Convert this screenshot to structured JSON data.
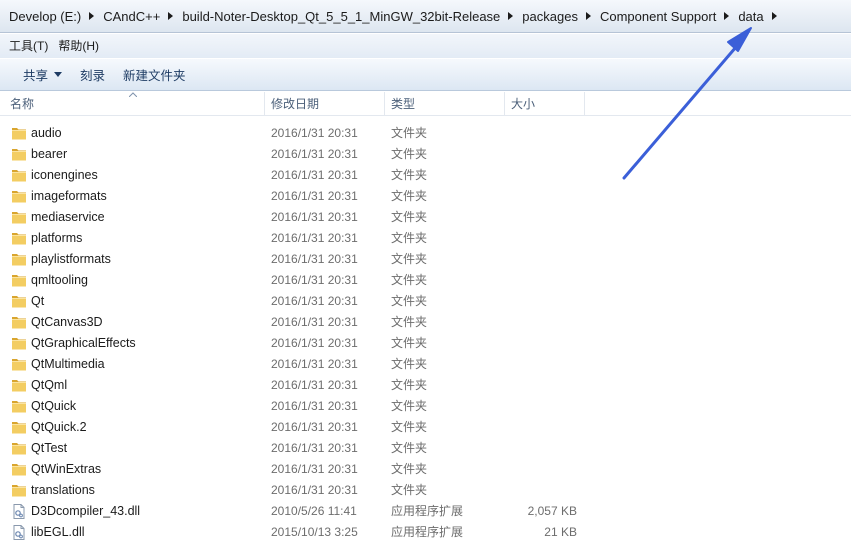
{
  "address": {
    "crumbs": [
      "Develop (E:)",
      "CAndC++",
      "build-Noter-Desktop_Qt_5_5_1_MinGW_32bit-Release",
      "packages",
      "Component Support",
      "data"
    ]
  },
  "menu": {
    "items": [
      "工具(T)",
      "帮助(H)"
    ]
  },
  "toolbar": {
    "share": "共享",
    "burn": "刻录",
    "new_folder": "新建文件夹"
  },
  "columns": {
    "name": "名称",
    "date": "修改日期",
    "type": "类型",
    "size": "大小"
  },
  "files": [
    {
      "name": "audio",
      "date": "2016/1/31 20:31",
      "type": "文件夹",
      "size": "",
      "icon": "folder-icon"
    },
    {
      "name": "bearer",
      "date": "2016/1/31 20:31",
      "type": "文件夹",
      "size": "",
      "icon": "folder-icon"
    },
    {
      "name": "iconengines",
      "date": "2016/1/31 20:31",
      "type": "文件夹",
      "size": "",
      "icon": "folder-icon"
    },
    {
      "name": "imageformats",
      "date": "2016/1/31 20:31",
      "type": "文件夹",
      "size": "",
      "icon": "folder-icon"
    },
    {
      "name": "mediaservice",
      "date": "2016/1/31 20:31",
      "type": "文件夹",
      "size": "",
      "icon": "folder-icon"
    },
    {
      "name": "platforms",
      "date": "2016/1/31 20:31",
      "type": "文件夹",
      "size": "",
      "icon": "folder-icon"
    },
    {
      "name": "playlistformats",
      "date": "2016/1/31 20:31",
      "type": "文件夹",
      "size": "",
      "icon": "folder-icon"
    },
    {
      "name": "qmltooling",
      "date": "2016/1/31 20:31",
      "type": "文件夹",
      "size": "",
      "icon": "folder-icon"
    },
    {
      "name": "Qt",
      "date": "2016/1/31 20:31",
      "type": "文件夹",
      "size": "",
      "icon": "folder-icon"
    },
    {
      "name": "QtCanvas3D",
      "date": "2016/1/31 20:31",
      "type": "文件夹",
      "size": "",
      "icon": "folder-icon"
    },
    {
      "name": "QtGraphicalEffects",
      "date": "2016/1/31 20:31",
      "type": "文件夹",
      "size": "",
      "icon": "folder-icon"
    },
    {
      "name": "QtMultimedia",
      "date": "2016/1/31 20:31",
      "type": "文件夹",
      "size": "",
      "icon": "folder-icon"
    },
    {
      "name": "QtQml",
      "date": "2016/1/31 20:31",
      "type": "文件夹",
      "size": "",
      "icon": "folder-icon"
    },
    {
      "name": "QtQuick",
      "date": "2016/1/31 20:31",
      "type": "文件夹",
      "size": "",
      "icon": "folder-icon"
    },
    {
      "name": "QtQuick.2",
      "date": "2016/1/31 20:31",
      "type": "文件夹",
      "size": "",
      "icon": "folder-icon"
    },
    {
      "name": "QtTest",
      "date": "2016/1/31 20:31",
      "type": "文件夹",
      "size": "",
      "icon": "folder-icon"
    },
    {
      "name": "QtWinExtras",
      "date": "2016/1/31 20:31",
      "type": "文件夹",
      "size": "",
      "icon": "folder-icon"
    },
    {
      "name": "translations",
      "date": "2016/1/31 20:31",
      "type": "文件夹",
      "size": "",
      "icon": "folder-icon"
    },
    {
      "name": "D3Dcompiler_43.dll",
      "date": "2010/5/26 11:41",
      "type": "应用程序扩展",
      "size": "2,057 KB",
      "icon": "dll-file-icon"
    },
    {
      "name": "libEGL.dll",
      "date": "2015/10/13 3:25",
      "type": "应用程序扩展",
      "size": "21 KB",
      "icon": "dll-file-icon"
    }
  ],
  "colors": {
    "accent_arrow": "#3b5fd8",
    "folder": "#e8b846"
  }
}
